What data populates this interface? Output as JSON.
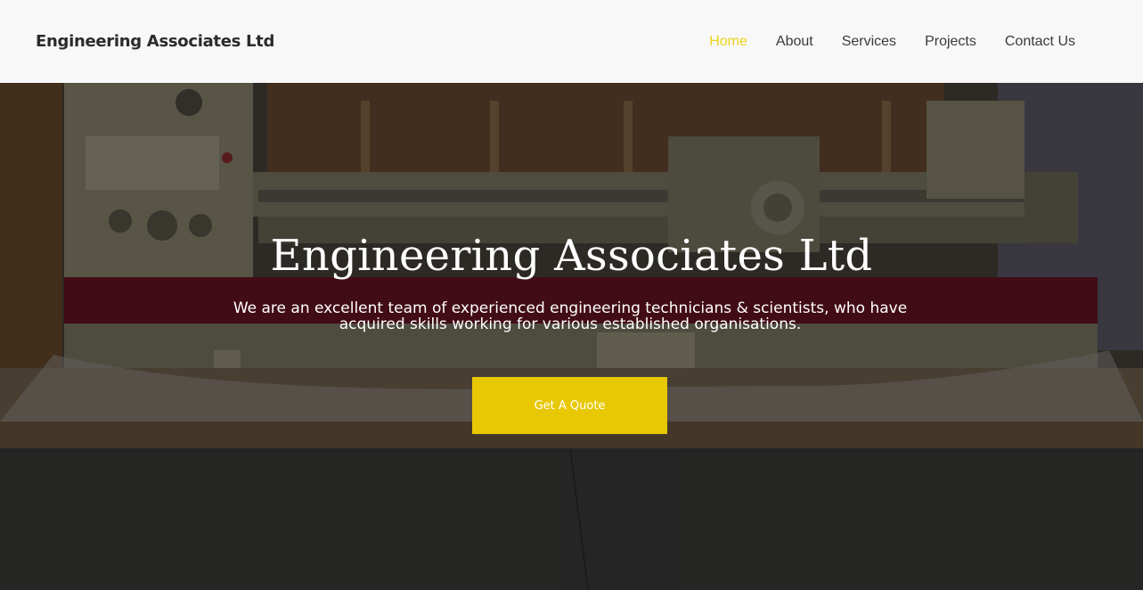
{
  "header": {
    "brand": "Engineering Associates Ltd",
    "nav": [
      {
        "label": "Home",
        "active": true
      },
      {
        "label": "About",
        "active": false
      },
      {
        "label": "Services",
        "active": false
      },
      {
        "label": "Projects",
        "active": false
      },
      {
        "label": "Contact Us",
        "active": false
      }
    ]
  },
  "hero": {
    "title": "Engineering Associates Ltd",
    "subtitle_line1": "We are an excellent team of experienced engineering technicians & scientists, who have",
    "subtitle_line2": "acquired skills working for various established organisations.",
    "cta_label": "Get A Quote"
  },
  "colors": {
    "accent": "#e8c804",
    "nav_active": "#ead41a",
    "header_bg": "#f8f8f8"
  }
}
